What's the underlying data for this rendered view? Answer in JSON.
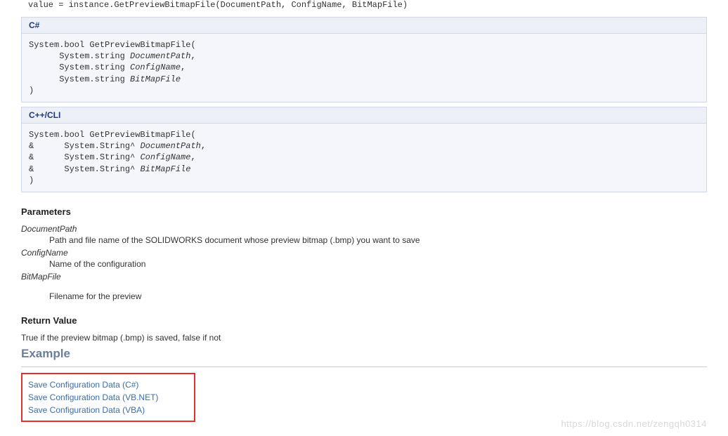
{
  "top_code_line": "value = instance.GetPreviewBitmapFile(DocumentPath, ConfigName, BitMapFile)",
  "csharp": {
    "label": "C#",
    "code": "System.bool GetPreviewBitmapFile(\n      System.string <span class=\"italic\">DocumentPath</span>,\n      System.string <span class=\"italic\">ConfigName</span>,\n      System.string <span class=\"italic\">BitMapFile</span>\n)"
  },
  "cppcli": {
    "label": "C++/CLI",
    "code": "System.bool GetPreviewBitmapFile(\n&      System.String^ <span class=\"italic\">DocumentPath</span>,\n&      System.String^ <span class=\"italic\">ConfigName</span>,\n&      System.String^ <span class=\"italic\">BitMapFile</span>\n)"
  },
  "parameters_heading": "Parameters",
  "params": {
    "p1_name": "DocumentPath",
    "p1_desc": "Path and file name of the SOLIDWORKS document whose preview bitmap (.bmp) you want to save",
    "p2_name": "ConfigName",
    "p2_desc": "Name of the configuration",
    "p3_name": "BitMapFile",
    "p3_desc": "Filename for the preview"
  },
  "return_heading": "Return Value",
  "return_text": "True if the preview bitmap (.bmp) is saved, false if not",
  "example_heading": "Example",
  "example_links": {
    "l1": "Save Configuration Data (C#)",
    "l2": "Save Configuration Data (VB.NET)",
    "l3": "Save Configuration Data (VBA)"
  },
  "watermark": "https://blog.csdn.net/zengqh0314"
}
